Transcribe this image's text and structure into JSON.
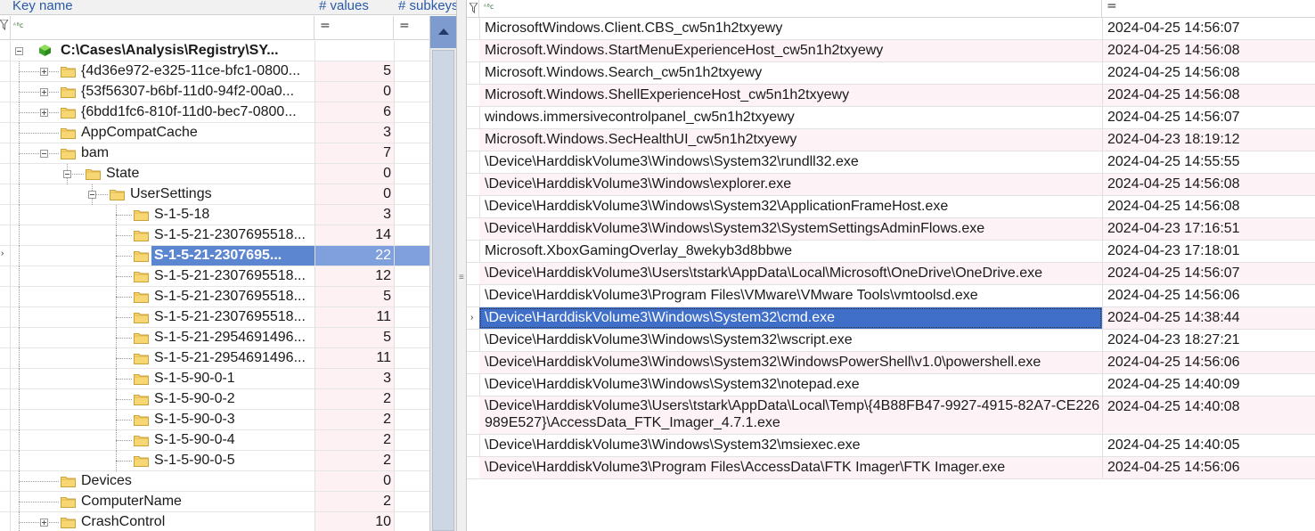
{
  "left_header": {
    "col_key": "Key name",
    "col_values": "# values",
    "col_subkeys": "# subkeys"
  },
  "left_filter": {
    "name_op": "=",
    "values_op": "="
  },
  "tree": [
    {
      "name": "C:\\Cases\\Analysis\\Registry\\SY...",
      "values": ""
    },
    {
      "name": "{4d36e972-e325-11ce-bfc1-0800...",
      "values": "5"
    },
    {
      "name": "{53f56307-b6bf-11d0-94f2-00a0...",
      "values": "0"
    },
    {
      "name": "{6bdd1fc6-810f-11d0-bec7-0800...",
      "values": "6"
    },
    {
      "name": "AppCompatCache",
      "values": "3"
    },
    {
      "name": "bam",
      "values": "7"
    },
    {
      "name": "State",
      "values": "0"
    },
    {
      "name": "UserSettings",
      "values": "0"
    },
    {
      "name": "S-1-5-18",
      "values": "3"
    },
    {
      "name": "S-1-5-21-2307695518...",
      "values": "14"
    },
    {
      "name": "S-1-5-21-2307695...",
      "values": "22"
    },
    {
      "name": "S-1-5-21-2307695518...",
      "values": "12"
    },
    {
      "name": "S-1-5-21-2307695518...",
      "values": "5"
    },
    {
      "name": "S-1-5-21-2307695518...",
      "values": "11"
    },
    {
      "name": "S-1-5-21-2954691496...",
      "values": "5"
    },
    {
      "name": "S-1-5-21-2954691496...",
      "values": "11"
    },
    {
      "name": "S-1-5-90-0-1",
      "values": "3"
    },
    {
      "name": "S-1-5-90-0-2",
      "values": "2"
    },
    {
      "name": "S-1-5-90-0-3",
      "values": "2"
    },
    {
      "name": "S-1-5-90-0-4",
      "values": "2"
    },
    {
      "name": "S-1-5-90-0-5",
      "values": "2"
    },
    {
      "name": "Devices",
      "values": "0"
    },
    {
      "name": "ComputerName",
      "values": "2"
    },
    {
      "name": "CrashControl",
      "values": "10"
    }
  ],
  "right_filter": {
    "value_op": "="
  },
  "entries": [
    {
      "value": "MicrosoftWindows.Client.CBS_cw5n1h2txyewy",
      "time": "2024-04-25 14:56:07"
    },
    {
      "value": "Microsoft.Windows.StartMenuExperienceHost_cw5n1h2txyewy",
      "time": "2024-04-25 14:56:08"
    },
    {
      "value": "Microsoft.Windows.Search_cw5n1h2txyewy",
      "time": "2024-04-25 14:56:08"
    },
    {
      "value": "Microsoft.Windows.ShellExperienceHost_cw5n1h2txyewy",
      "time": "2024-04-25 14:56:08"
    },
    {
      "value": "windows.immersivecontrolpanel_cw5n1h2txyewy",
      "time": "2024-04-25 14:56:07"
    },
    {
      "value": "Microsoft.Windows.SecHealthUI_cw5n1h2txyewy",
      "time": "2024-04-23 18:19:12"
    },
    {
      "value": "\\Device\\HarddiskVolume3\\Windows\\System32\\rundll32.exe",
      "time": "2024-04-25 14:55:55"
    },
    {
      "value": "\\Device\\HarddiskVolume3\\Windows\\explorer.exe",
      "time": "2024-04-25 14:56:08"
    },
    {
      "value": "\\Device\\HarddiskVolume3\\Windows\\System32\\ApplicationFrameHost.exe",
      "time": "2024-04-25 14:56:08"
    },
    {
      "value": "\\Device\\HarddiskVolume3\\Windows\\System32\\SystemSettingsAdminFlows.exe",
      "time": "2024-04-23 17:16:51"
    },
    {
      "value": "Microsoft.XboxGamingOverlay_8wekyb3d8bbwe",
      "time": "2024-04-23 17:18:01"
    },
    {
      "value": "\\Device\\HarddiskVolume3\\Users\\tstark\\AppData\\Local\\Microsoft\\OneDrive\\OneDrive.exe",
      "time": "2024-04-25 14:56:07"
    },
    {
      "value": "\\Device\\HarddiskVolume3\\Program Files\\VMware\\VMware Tools\\vmtoolsd.exe",
      "time": "2024-04-25 14:56:06"
    },
    {
      "value": "\\Device\\HarddiskVolume3\\Windows\\System32\\cmd.exe",
      "time": "2024-04-25 14:38:44"
    },
    {
      "value": "\\Device\\HarddiskVolume3\\Windows\\System32\\wscript.exe",
      "time": "2024-04-23 18:27:21"
    },
    {
      "value": "\\Device\\HarddiskVolume3\\Windows\\System32\\WindowsPowerShell\\v1.0\\powershell.exe",
      "time": "2024-04-25 14:56:06"
    },
    {
      "value": "\\Device\\HarddiskVolume3\\Windows\\System32\\notepad.exe",
      "time": "2024-04-25 14:40:09"
    },
    {
      "value": "\\Device\\HarddiskVolume3\\Users\\tstark\\AppData\\Local\\Temp\\{4B88FB47-9927-4915-82A7-CE226989E527}\\AccessData_FTK_Imager_4.7.1.exe",
      "time": "2024-04-25 14:40:08"
    },
    {
      "value": "\\Device\\HarddiskVolume3\\Windows\\System32\\msiexec.exe",
      "time": "2024-04-25 14:40:05"
    },
    {
      "value": "\\Device\\HarddiskVolume3\\Program Files\\AccessData\\FTK Imager\\FTK Imager.exe",
      "time": "2024-04-25 14:56:06"
    }
  ],
  "colors": {
    "selection": "#5d86d1",
    "selection_right": "#3f6fc9",
    "header_text": "#2a5aa8",
    "alt_row": "#fdf3f6"
  }
}
